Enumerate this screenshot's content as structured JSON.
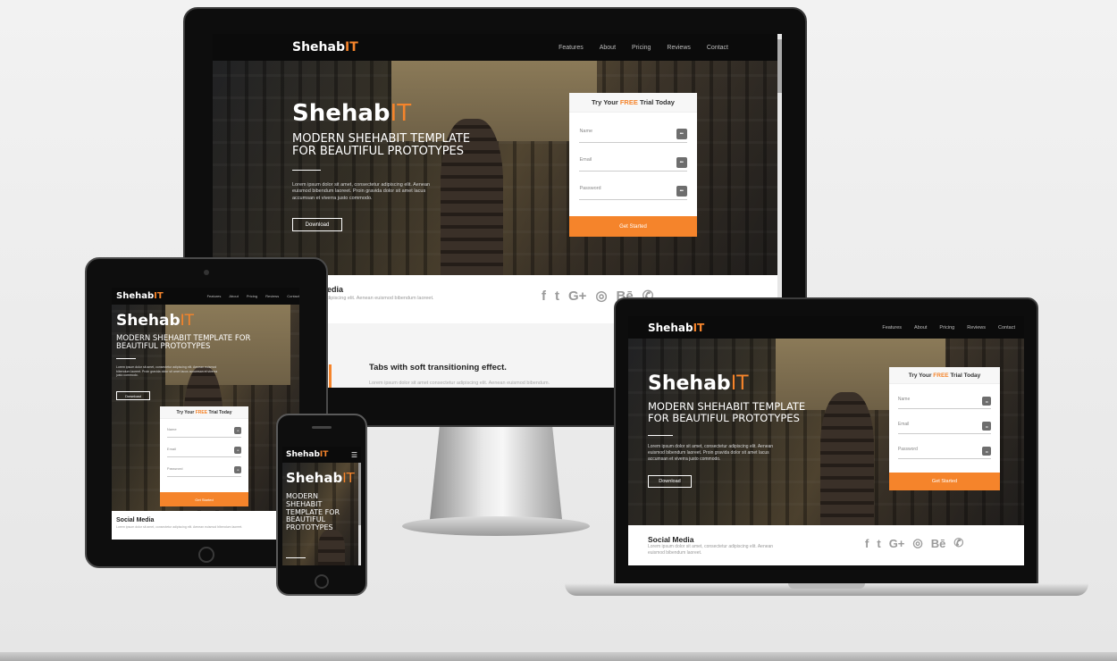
{
  "site": {
    "logo_main": "Shehab",
    "logo_accent": "IT",
    "nav": [
      "Features",
      "About",
      "Pricing",
      "Reviews",
      "Contact"
    ],
    "hero_title_main": "Shehab",
    "hero_title_accent": "IT",
    "hero_subtitle": "MODERN SHEHABIT TEMPLATE FOR BEAUTIFUL PROTOTYPES",
    "hero_text": "Lorem ipsum dolor sit amet, consectetur adipiscing elit. Aenean euismod bibendum laoreet. Proin gravida dolor sit amet lacus accumsan et viverra justo commodo.",
    "download_label": "Download",
    "form_title_pre": "Try Your ",
    "form_title_accent": "FREE",
    "form_title_post": " Trial Today",
    "fields": [
      "Name",
      "Email",
      "Password"
    ],
    "field_icon": "•••",
    "submit_label": "Get Started",
    "social_title": "Social Media",
    "social_title_partial": "edia",
    "social_text": "Lorem ipsum dolor sit amet, consectetur adipiscing elit. Aenean euismod bibendum laoreet.",
    "social_text_partial": "dipiscing elit. Aenean euismod bibendum laoreet.",
    "social_icons": [
      "f",
      "t",
      "G+",
      "◎",
      "Bē",
      "✆"
    ],
    "tabs_heading": "Tabs with soft transitioning effect.",
    "tabs_text": "Lorem ipsum dolor sit amet consectetur adipiscing elit. Aenean euismod bibendum."
  },
  "colors": {
    "accent": "#f5842b",
    "nav": "#0b0b0b",
    "device_frame": "#111111"
  },
  "icons": {
    "facebook": "f",
    "twitter": "t",
    "google_plus": "G+",
    "instagram": "◎",
    "behance": "Bē",
    "whatsapp": "✆",
    "menu": "☰"
  }
}
